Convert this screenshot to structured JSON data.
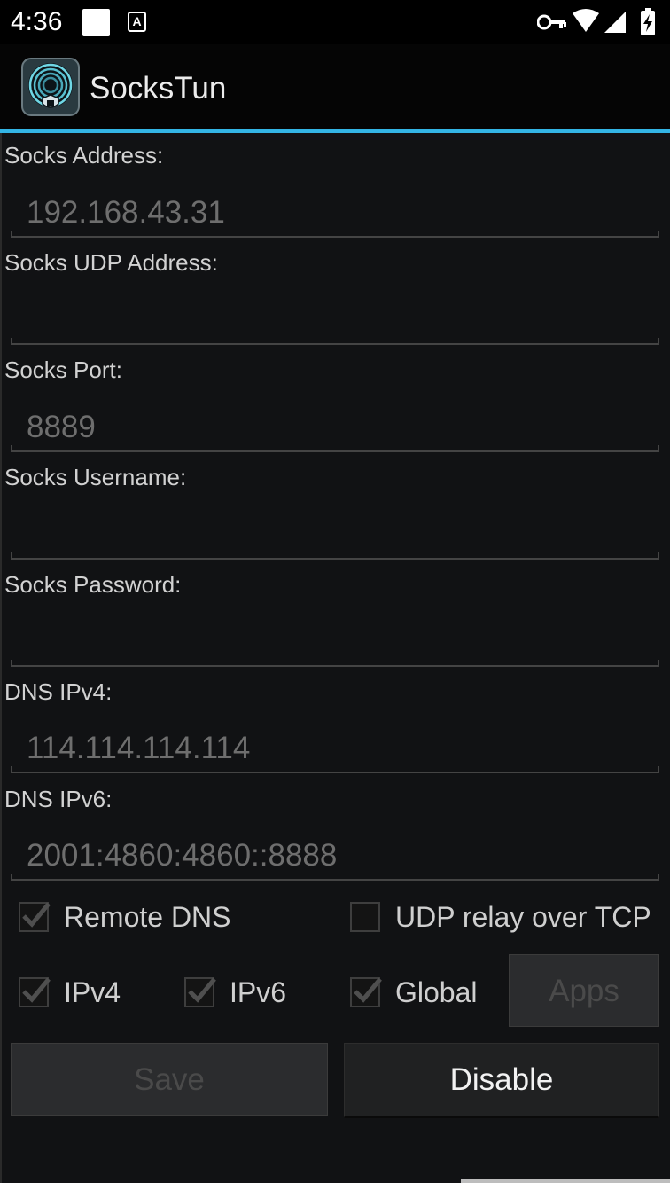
{
  "status_bar": {
    "time": "4:36",
    "a_icon_letter": "A",
    "icons": [
      "notification-square-icon",
      "a-keyboard-icon",
      "vpn-key-icon",
      "wifi-icon",
      "signal-icon",
      "battery-charging-icon"
    ]
  },
  "app": {
    "title": "SocksTun",
    "accent_color": "#33b5e5"
  },
  "form": {
    "socks_address": {
      "label": "Socks Address:",
      "value": "192.168.43.31"
    },
    "socks_udp_address": {
      "label": "Socks UDP Address:",
      "value": ""
    },
    "socks_port": {
      "label": "Socks Port:",
      "value": "8889"
    },
    "socks_username": {
      "label": "Socks Username:",
      "value": ""
    },
    "socks_password": {
      "label": "Socks Password:",
      "value": ""
    },
    "dns_ipv4": {
      "label": "DNS IPv4:",
      "value": "114.114.114.114"
    },
    "dns_ipv6": {
      "label": "DNS IPv6:",
      "value": "2001:4860:4860::8888"
    }
  },
  "options": {
    "remote_dns": {
      "label": "Remote DNS",
      "checked": true
    },
    "udp_relay": {
      "label": "UDP relay over TCP",
      "checked": false
    },
    "ipv4": {
      "label": "IPv4",
      "checked": true
    },
    "ipv6": {
      "label": "IPv6",
      "checked": true
    },
    "global": {
      "label": "Global",
      "checked": true
    }
  },
  "buttons": {
    "apps": {
      "label": "Apps",
      "enabled": false
    },
    "save": {
      "label": "Save",
      "enabled": false
    },
    "disable": {
      "label": "Disable",
      "enabled": true
    }
  }
}
